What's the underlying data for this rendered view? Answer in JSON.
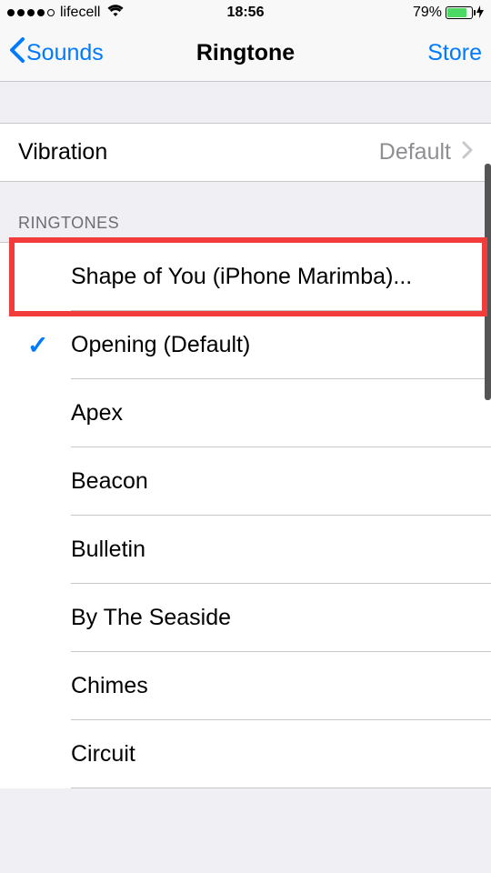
{
  "status": {
    "carrier": "lifecell",
    "time": "18:56",
    "battery_pct": "79%"
  },
  "nav": {
    "back_label": "Sounds",
    "title": "Ringtone",
    "store": "Store"
  },
  "vibration": {
    "label": "Vibration",
    "value": "Default"
  },
  "section": {
    "ringtones_header": "RINGTONES"
  },
  "ringtones": {
    "highlighted": "Shape of You (iPhone Marimba)...",
    "items": [
      "Opening (Default)",
      "Apex",
      "Beacon",
      "Bulletin",
      "By The Seaside",
      "Chimes",
      "Circuit"
    ]
  }
}
